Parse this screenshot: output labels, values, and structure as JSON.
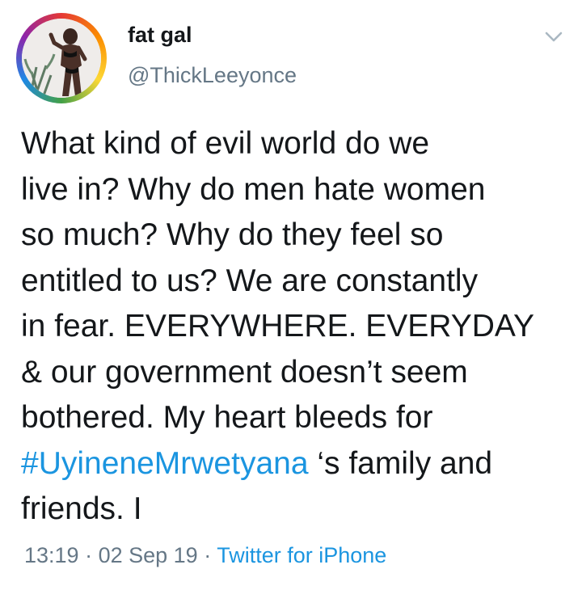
{
  "user": {
    "display_name": "fat gal",
    "handle": "@ThickLeeyonce",
    "avatar_icon": "profile-photo-avatar"
  },
  "tweet": {
    "lines": [
      "What kind of evil world do we",
      "live in? Why do men hate women",
      "so much? Why do they feel so",
      "entitled to us? We are constantly",
      "in fear. EVERYWHERE. EVERYDAY",
      "& our government doesn’t seem",
      "bothered. My heart bleeds for"
    ],
    "hashtag": "#UyineneMrwetyana",
    "hashtag_suffix": " ‘s family and",
    "last_line": "friends. I"
  },
  "meta": {
    "time": "13:19",
    "date": "02 Sep 19",
    "separator": " · ",
    "source": "Twitter for iPhone"
  },
  "colors": {
    "link": "#1b95e0",
    "muted": "#657786",
    "text": "#14171a"
  },
  "icons": {
    "menu": "chevron-down-icon"
  }
}
